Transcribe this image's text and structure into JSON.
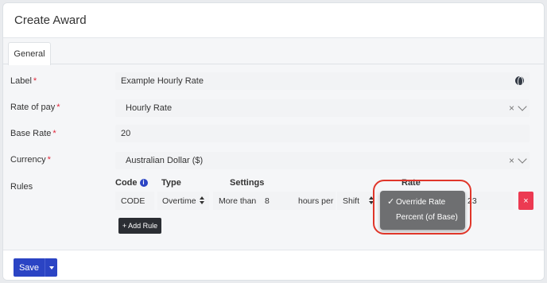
{
  "header": {
    "title": "Create Award"
  },
  "tabs": [
    {
      "label": "General"
    }
  ],
  "form": {
    "label": {
      "label": "Label",
      "required": "*",
      "value": "Example Hourly Rate",
      "icon": "globe-icon"
    },
    "rate_of_pay": {
      "label": "Rate of pay",
      "required": "*",
      "value": "Hourly Rate",
      "clear": "×"
    },
    "base_rate": {
      "label": "Base Rate",
      "required": "*",
      "value": "20"
    },
    "currency": {
      "label": "Currency",
      "required": "*",
      "value": "Australian Dollar ($)",
      "clear": "×"
    },
    "rules": {
      "label": "Rules"
    }
  },
  "rules_table": {
    "headers": {
      "code": "Code",
      "type": "Type",
      "settings": "Settings",
      "rate": "Rate"
    },
    "info_icon": "i",
    "row": {
      "code": "CODE",
      "type": "Overtime",
      "condition": "More than",
      "hours": "8",
      "per_label": "hours per",
      "period": "Shift",
      "rate_value": "23",
      "delete": "×"
    },
    "add_rule": "+ Add Rule"
  },
  "rate_dropdown": {
    "options": [
      {
        "label": "Override Rate",
        "selected": true
      },
      {
        "label": "Percent (of Base)",
        "selected": false
      }
    ],
    "check": "✓"
  },
  "footer": {
    "save_label": "Save"
  },
  "colors": {
    "primary": "#2b44c4",
    "danger": "#ec3a52",
    "required": "#e0263a",
    "annotation": "#e0362a"
  }
}
